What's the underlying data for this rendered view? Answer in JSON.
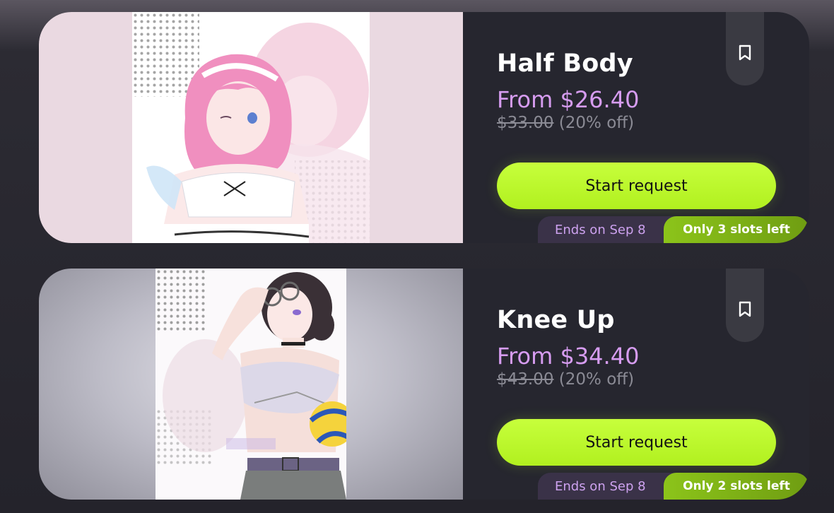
{
  "listings": [
    {
      "title": "Half Body",
      "price": "From $26.40",
      "original_price": "$33.00",
      "discount": "(20% off)",
      "button_label": "Start request",
      "ends_label": "Ends on Sep 8",
      "slots_label": "Only 3 slots left",
      "art_icon": "pink-haired-character-artwork",
      "bookmark_icon": "bookmark-icon"
    },
    {
      "title": "Knee Up",
      "price": "From $34.40",
      "original_price": "$43.00",
      "discount": "(20% off)",
      "button_label": "Start request",
      "ends_label": "Ends on Sep 8",
      "slots_label": "Only 2 slots left",
      "art_icon": "dark-haired-character-artwork",
      "bookmark_icon": "bookmark-icon"
    }
  ],
  "colors": {
    "accent_green": "#b8f52a",
    "price_purple": "#d69cf0",
    "card_bg": "#26262f"
  }
}
